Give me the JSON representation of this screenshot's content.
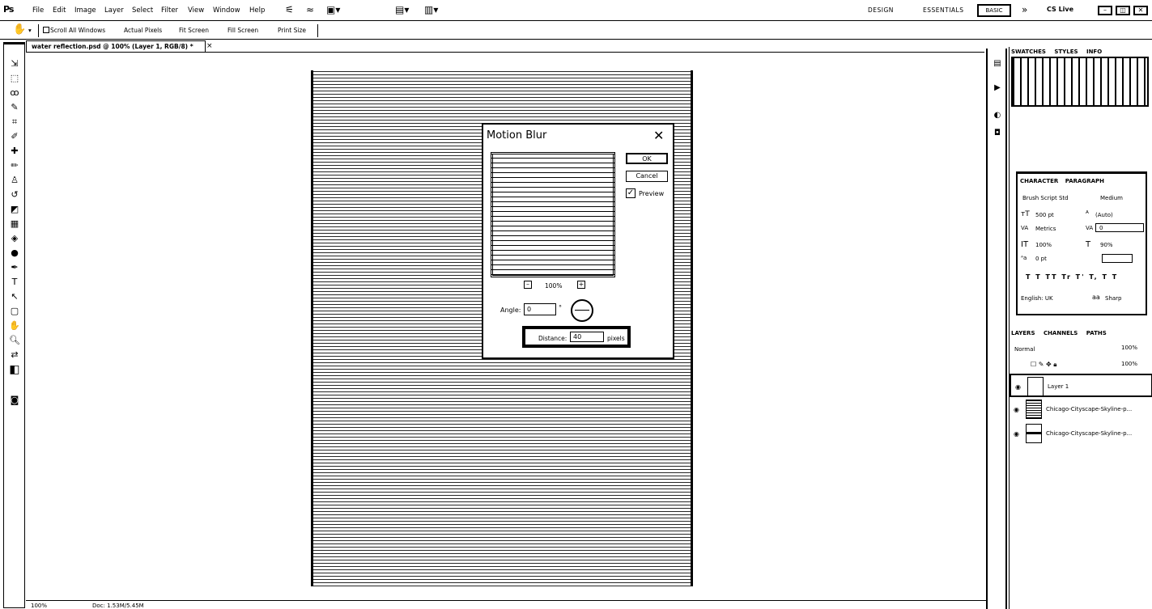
{
  "app": {
    "logo": "Ps"
  },
  "menu": [
    "File",
    "Edit",
    "Image",
    "Layer",
    "Select",
    "Filter",
    "View",
    "Window",
    "Help"
  ],
  "workspaces": {
    "design": "DESIGN",
    "essentials": "ESSENTIALS",
    "active": "BASIC",
    "more": "»",
    "cslive": "CS Live"
  },
  "options": {
    "scroll_all": "Scroll All Windows",
    "actual": "Actual Pixels",
    "fit": "Fit Screen",
    "fill": "Fill Screen",
    "print": "Print Size"
  },
  "document": {
    "tab": "water reflection.psd @ 100% (Layer 1, RGB/8) *",
    "close": "×"
  },
  "dialog": {
    "title": "Motion Blur",
    "close": "✕",
    "ok": "OK",
    "cancel": "Cancel",
    "preview_label": "Preview",
    "preview_checked": true,
    "zoom": "100%",
    "angle_label": "Angle:",
    "angle_value": "0",
    "angle_unit": "°",
    "distance_label": "Distance:",
    "distance_value": "40",
    "distance_unit": "pixels"
  },
  "panels": {
    "top_tabs": [
      "SWATCHES",
      "STYLES",
      "INFO"
    ],
    "char_tabs": [
      "CHARACTER",
      "PARAGRAPH"
    ],
    "char": {
      "font": "Brush Script Std",
      "style": "Medium",
      "size": "500 pt",
      "leading": "(Auto)",
      "kerning": "Metrics",
      "tracking": "0",
      "vscale": "100%",
      "hscale": "90%",
      "baseline": "0 pt",
      "styles": "T  T  TT  Tr  T'  T,  T  T",
      "language": "English: UK",
      "aa_label": "aa",
      "antialias": "Sharp"
    },
    "layer_tabs": [
      "LAYERS",
      "CHANNELS",
      "PATHS"
    ],
    "blend": "Normal",
    "opacity": "100%",
    "fill": "100%",
    "layers": [
      {
        "name": "Layer 1"
      },
      {
        "name": "Chicago-Cityscape-Skyline-p..."
      },
      {
        "name": "Chicago-Cityscape-Skyline-p..."
      }
    ]
  },
  "status": {
    "zoom": "100%",
    "doc": "Doc: 1.53M/5.45M"
  }
}
